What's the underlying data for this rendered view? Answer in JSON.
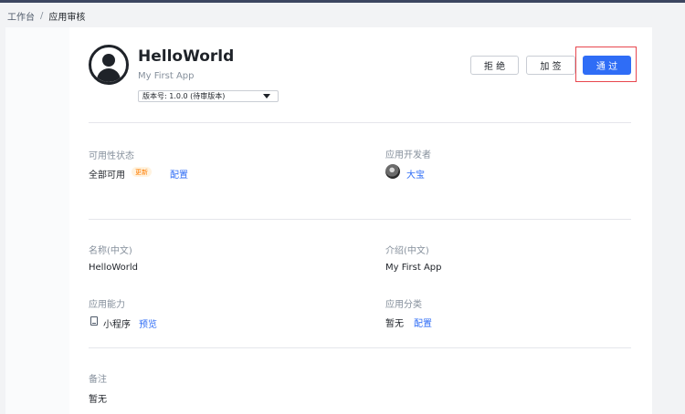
{
  "breadcrumb": {
    "root": "工作台",
    "separator": "/",
    "current": "应用审核"
  },
  "app": {
    "name": "HelloWorld",
    "subtitle": "My First App"
  },
  "version_select": {
    "value": "版本号: 1.0.0 (待审版本)"
  },
  "actions": {
    "reject": "拒 绝",
    "add_sign": "加 签",
    "pass": "通 过"
  },
  "availability": {
    "label": "可用性状态",
    "value": "全部可用",
    "badge": "更新",
    "config_link": "配置"
  },
  "developer": {
    "label": "应用开发者",
    "name": "大宝"
  },
  "name_field": {
    "label": "名称(中文)",
    "value": "HelloWorld"
  },
  "intro_field": {
    "label": "介绍(中文)",
    "value": "My First App"
  },
  "capability": {
    "label": "应用能力",
    "value": "小程序",
    "preview_link": "预览"
  },
  "category": {
    "label": "应用分类",
    "value": "暂无",
    "config_link": "配置"
  },
  "remark": {
    "label": "备注",
    "value": "暂无"
  },
  "colors": {
    "accent": "#2f6df6",
    "highlight_border": "#e8474e",
    "badge_text": "#ff7d00"
  }
}
